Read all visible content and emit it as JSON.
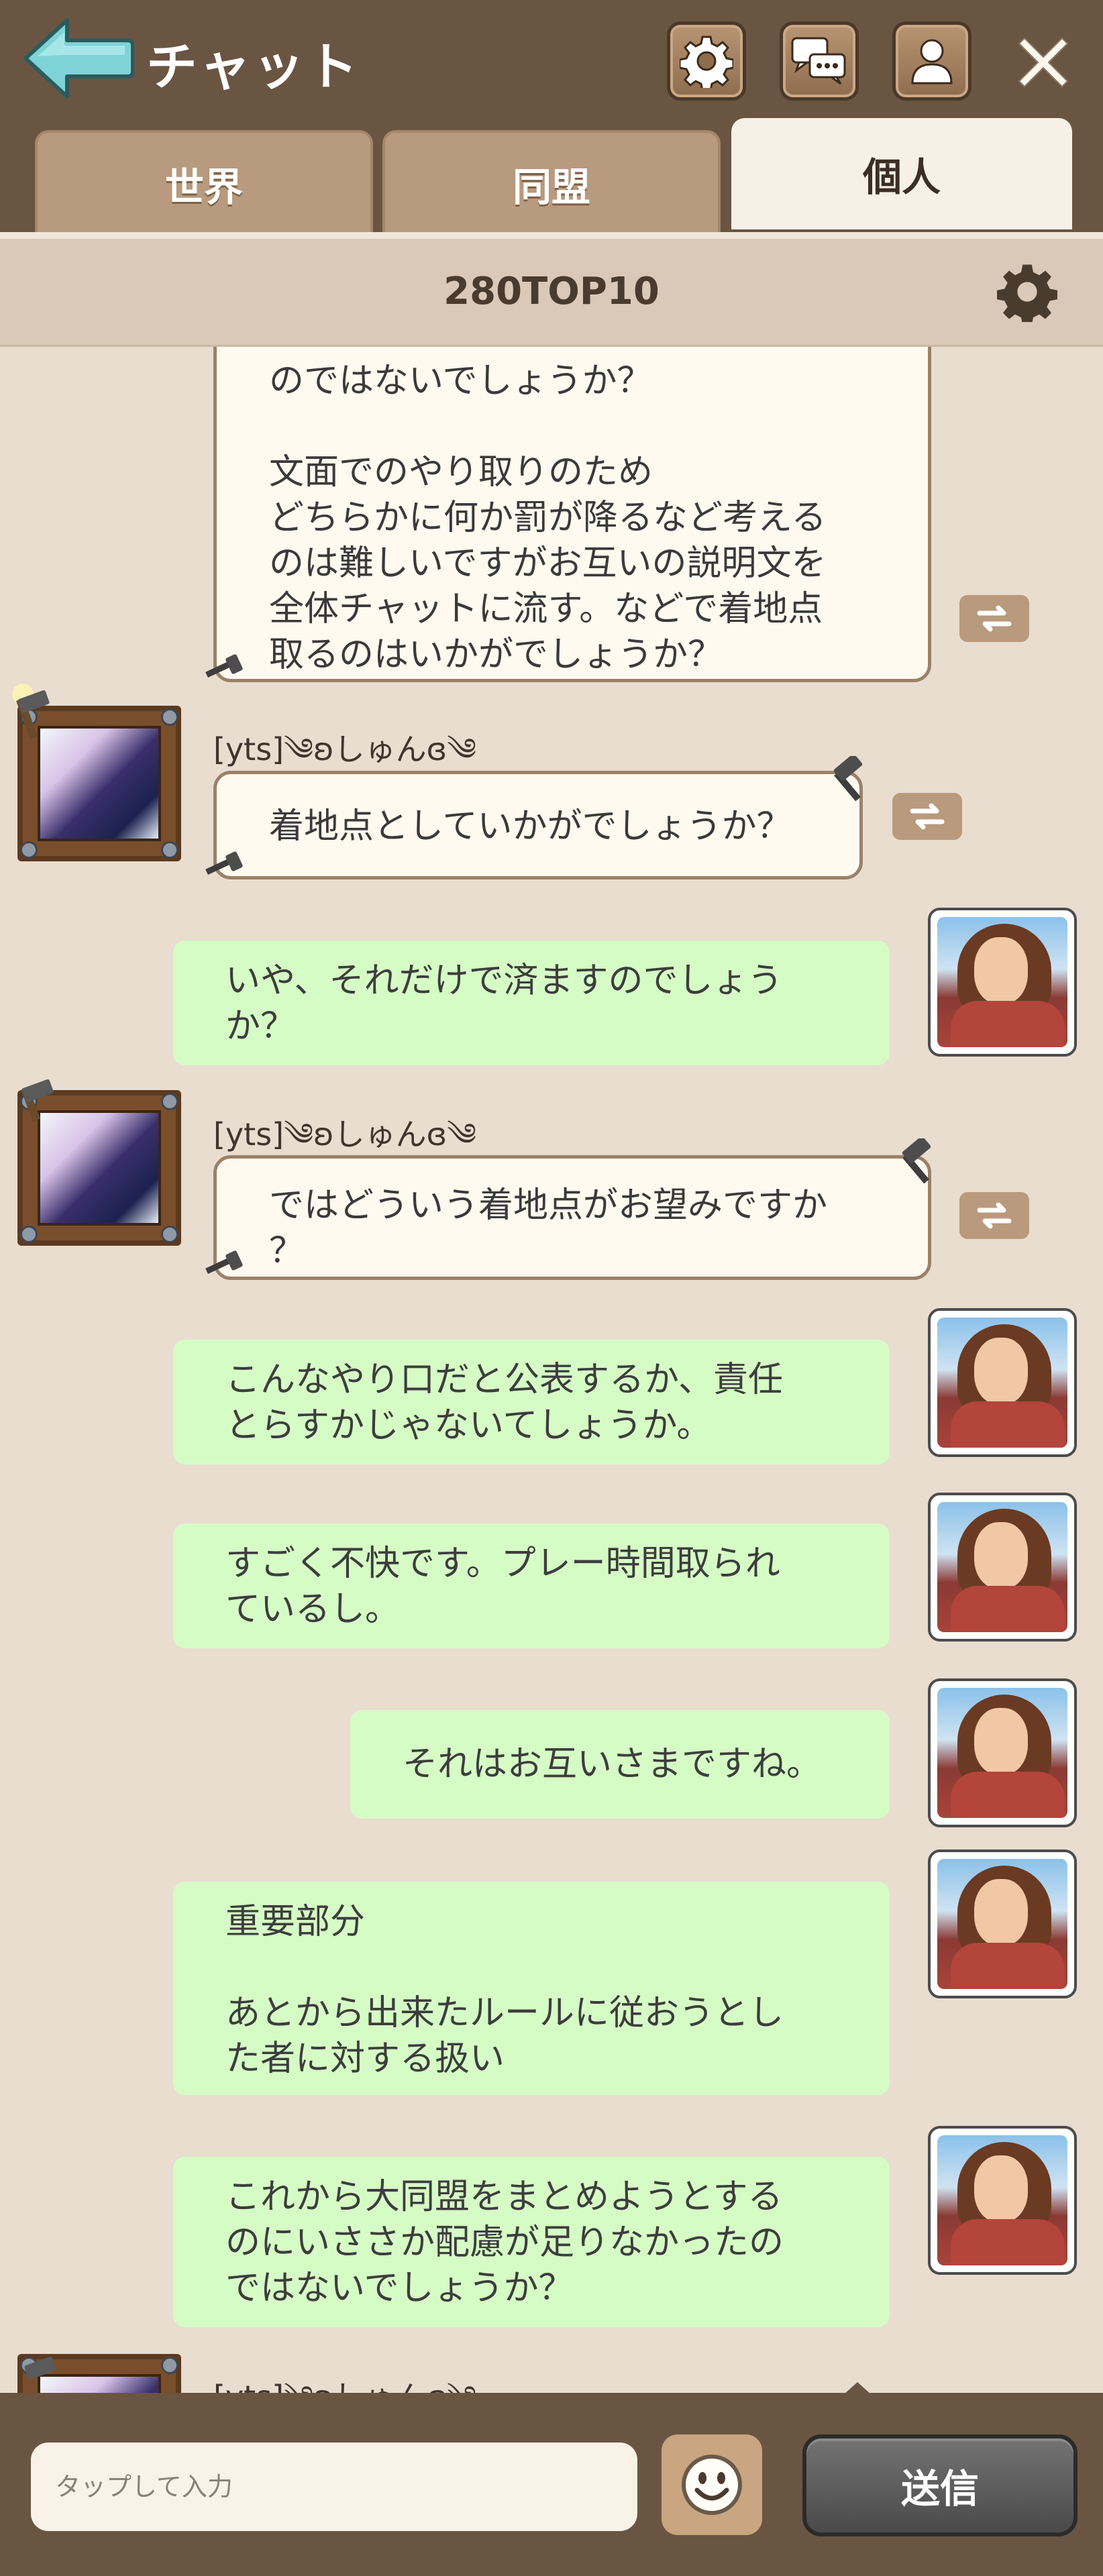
{
  "header": {
    "title": "チャット",
    "back_icon": "back-arrow-icon",
    "buttons": [
      "settings-gear-icon",
      "chat-bubbles-icon",
      "person-icon",
      "close-icon"
    ]
  },
  "tabs": [
    {
      "label": "世界",
      "active": false
    },
    {
      "label": "同盟",
      "active": false
    },
    {
      "label": "個人",
      "active": true
    }
  ],
  "room": {
    "name": "280TOP10"
  },
  "messages": [
    {
      "side": "in",
      "sender": "",
      "text": "のではないでしょうか？\n\n文面でのやり取りのため\nどちらかに何か罰が降るなど考える\nのは難しいですがお互いの説明文を\n全体チャットに流す。などで着地点\n取るのはいかがでしょうか？"
    },
    {
      "side": "in",
      "sender": "[yts]༄ʚしゅんɞ༄",
      "text": "着地点としていかがでしょうか？"
    },
    {
      "side": "out",
      "text": "いや、それだけで済ますのでしょう\nか？"
    },
    {
      "side": "in",
      "sender": "[yts]༄ʚしゅんɞ༄",
      "text": "ではどういう着地点がお望みですか\n？"
    },
    {
      "side": "out",
      "text": "こんなやり口だと公表するか、責任\nとらすかじゃないてしょうか。"
    },
    {
      "side": "out",
      "text": "すごく不快です。プレー時間取られ\nているし。"
    },
    {
      "side": "out",
      "text": "それはお互いさまですね。"
    },
    {
      "side": "out",
      "text": "重要部分\n\nあとから出来たルールに従おうとし\nた者に対する扱い"
    },
    {
      "side": "out",
      "text": "これから大同盟をまとめようとする\nのにいささか配慮が足りなかったの\nではないでしょうか？"
    },
    {
      "side": "in",
      "sender": "[yts]༄ʚしゅんɞ༄",
      "text": ""
    }
  ],
  "input": {
    "placeholder": "タップして入力"
  },
  "send_label": "送信",
  "colors": {
    "header_bg": "#6a5543",
    "incoming_bubble": "#fffaf0",
    "outgoing_bubble": "#d6fcc6",
    "chat_bg": "#e9ddd0"
  }
}
